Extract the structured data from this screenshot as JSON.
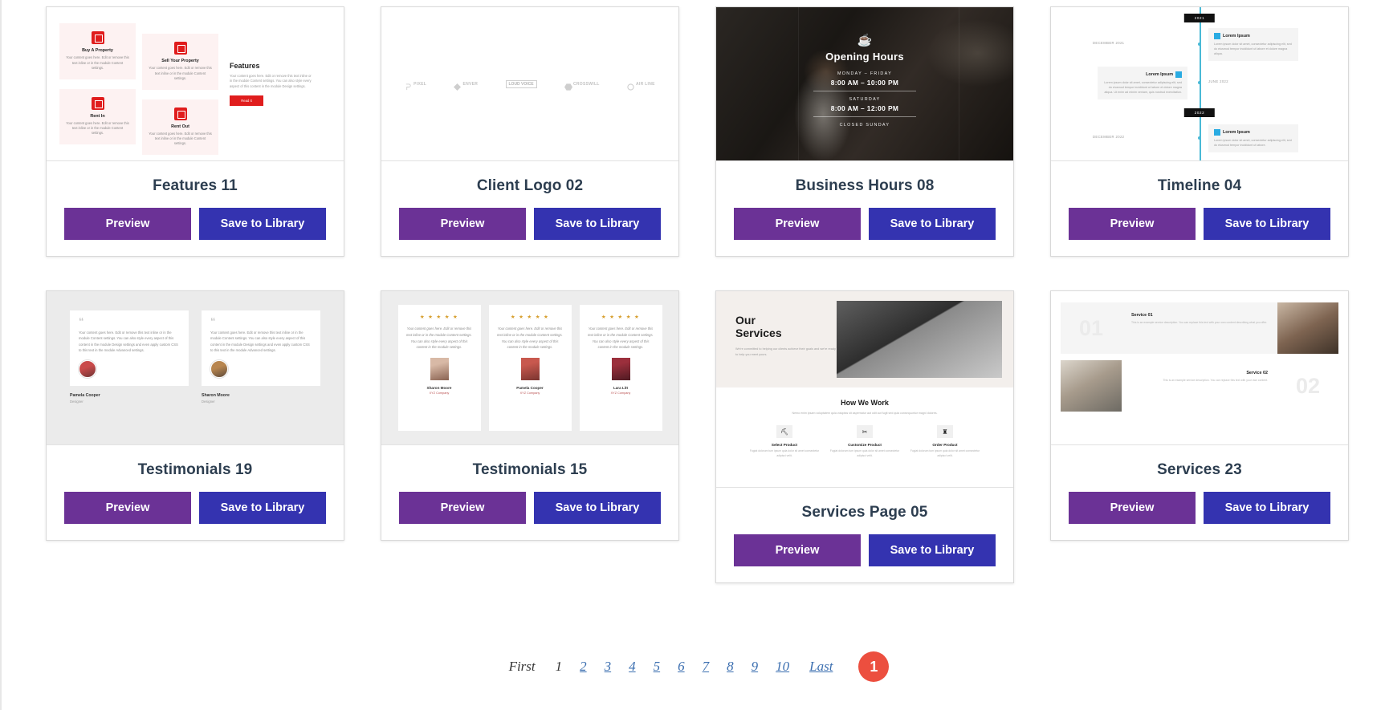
{
  "buttons": {
    "preview": "Preview",
    "save": "Save to Library"
  },
  "cards": [
    {
      "id": "features-11",
      "title": "Features 11",
      "thumb": {
        "kind": "features",
        "heading": "Features",
        "body": "Your content goes here. Edit or remove this text inline or in the module Content settings. You can also style every aspect of this content in the module Design settings.",
        "cta": "Read It",
        "tiles": [
          {
            "label": "Buy A Property",
            "text": "Your content goes here. Edit or remove this text inline or in the module Content settings."
          },
          {
            "label": "Sell Your Property",
            "text": "Your content goes here. Edit or remove this text inline or in the module Content settings."
          },
          {
            "label": "Rent In",
            "text": "Your content goes here. Edit or remove this text inline or in the module Content settings."
          },
          {
            "label": "Rent Out",
            "text": "Your content goes here. Edit or remove this text inline or in the module Content settings."
          }
        ]
      }
    },
    {
      "id": "client-logo-02",
      "title": "Client Logo 02",
      "thumb": {
        "kind": "clientlogo",
        "logos": [
          "PIXEL",
          "ENVER",
          "LOUD VOICE",
          "CROSSWILL",
          "AIR LINE"
        ]
      }
    },
    {
      "id": "business-hours-08",
      "title": "Business Hours 08",
      "thumb": {
        "kind": "hours",
        "icon": "coffee-cup-icon",
        "heading": "Opening Hours",
        "rows": [
          {
            "label": "MONDAY – FRIDAY",
            "time": "8:00 AM – 10:00 PM"
          },
          {
            "label": "SATURDAY",
            "time": "8:00 AM – 12:00 PM"
          }
        ],
        "closed": "CLOSED SUNDAY"
      }
    },
    {
      "id": "timeline-04",
      "title": "Timeline 04",
      "thumb": {
        "kind": "timeline",
        "years": [
          "2021",
          "2022"
        ],
        "entries": [
          {
            "heading": "Lorem Ipsum",
            "date": "DECEMBER 2021",
            "text": "Lorem ipsum dolor sit amet, consectetur adipiscing elit, sed do eiusmod tempor incididunt ut labore et dolore magna aliqua."
          },
          {
            "heading": "Lorem Ipsum",
            "date": "JUNE 2022",
            "text": "Lorem ipsum dolor sit amet, consectetur adipiscing elit, sed do eiusmod tempor incididunt ut labore et dolore magna aliqua. Ut enim ad minim veniam, quis nostrud exercitation."
          },
          {
            "heading": "Lorem Ipsum",
            "date": "DECEMBER 2022",
            "text": "Lorem ipsum dolor sit amet, consectetur adipiscing elit, sed do eiusmod tempor incididunt ut labore."
          }
        ]
      }
    },
    {
      "id": "testimonials-19",
      "title": "Testimonials 19",
      "thumb": {
        "kind": "t19",
        "quote_glyph": "“",
        "items": [
          {
            "text": "Your content goes here. Edit or remove this text inline or in the module Content settings. You can also style every aspect of this content in the module Design settings and even apply custom CSS to this text in the module Advanced settings.",
            "name": "Pamela Cooper",
            "role": "Designer"
          },
          {
            "text": "Your content goes here. Edit or remove this text inline or in the module Content settings. You can also style every aspect of this content in the module Design settings and even apply custom CSS to this text in the module Advanced settings.",
            "name": "Sharon Moore",
            "role": "Designer"
          }
        ]
      }
    },
    {
      "id": "testimonials-15",
      "title": "Testimonials 15",
      "thumb": {
        "kind": "t15",
        "stars": "★ ★ ★ ★ ★",
        "items": [
          {
            "text": "Your content goes here. Edit or remove this text inline or in the module Content settings. You can also style every aspect of this content in the module settings.",
            "name": "Sharon Moore",
            "role": "XYZ Company"
          },
          {
            "text": "Your content goes here. Edit or remove this text inline or in the module Content settings. You can also style every aspect of this content in the module settings.",
            "name": "Pamela Cooper",
            "role": "XYZ Company"
          },
          {
            "text": "Your content goes here. Edit or remove this text inline or in the module Content settings. You can also style every aspect of this content in the module settings.",
            "name": "Lara Litt",
            "role": "XYZ Company"
          }
        ]
      }
    },
    {
      "id": "services-page-05",
      "title": "Services Page 05",
      "thumb": {
        "kind": "services-page",
        "heading": "Our\nServices",
        "intro": "We're committed to helping our clients achieve their goals and we're ready to help you meet yours.",
        "how_heading": "How We Work",
        "how_intro": "Nemo enim ipsam voluptatem quia voluptas sit aspernatur aut odit aut fugit sed quia consequuntur magni dolores.",
        "steps": [
          {
            "icon": "sofa-icon",
            "glyph": "⛏",
            "title": "Select Product",
            "text": "Fugiat dolorum tum ipsum quia dolor sit amet consectetur adipisci velit."
          },
          {
            "icon": "scissors-icon",
            "glyph": "✂",
            "title": "Customize Product",
            "text": "Fugiat dolorum tum ipsum quia dolor sit amet consectetur adipisci velit."
          },
          {
            "icon": "truck-icon",
            "glyph": "♜",
            "title": "Order Product",
            "text": "Fugiat dolorum tum ipsum quia dolor sit amet consectetur adipisci velit."
          }
        ]
      }
    },
    {
      "id": "services-23",
      "title": "Services 23",
      "thumb": {
        "kind": "services23",
        "rows": [
          {
            "number": "01",
            "title": "Service 01",
            "text": "This is an example service description. You can replace this text with your own content describing what you offer.",
            "align": "left"
          },
          {
            "number": "02",
            "title": "Service 02",
            "text": "This is an example service description. You can replace this text with your own content.",
            "align": "right"
          }
        ]
      }
    }
  ],
  "pagination": {
    "first": "First",
    "last": "Last",
    "pages": [
      "1",
      "2",
      "3",
      "4",
      "5",
      "6",
      "7",
      "8",
      "9",
      "10"
    ],
    "current": "1",
    "badge": "1",
    "badge_color": "#ec4f3f"
  }
}
